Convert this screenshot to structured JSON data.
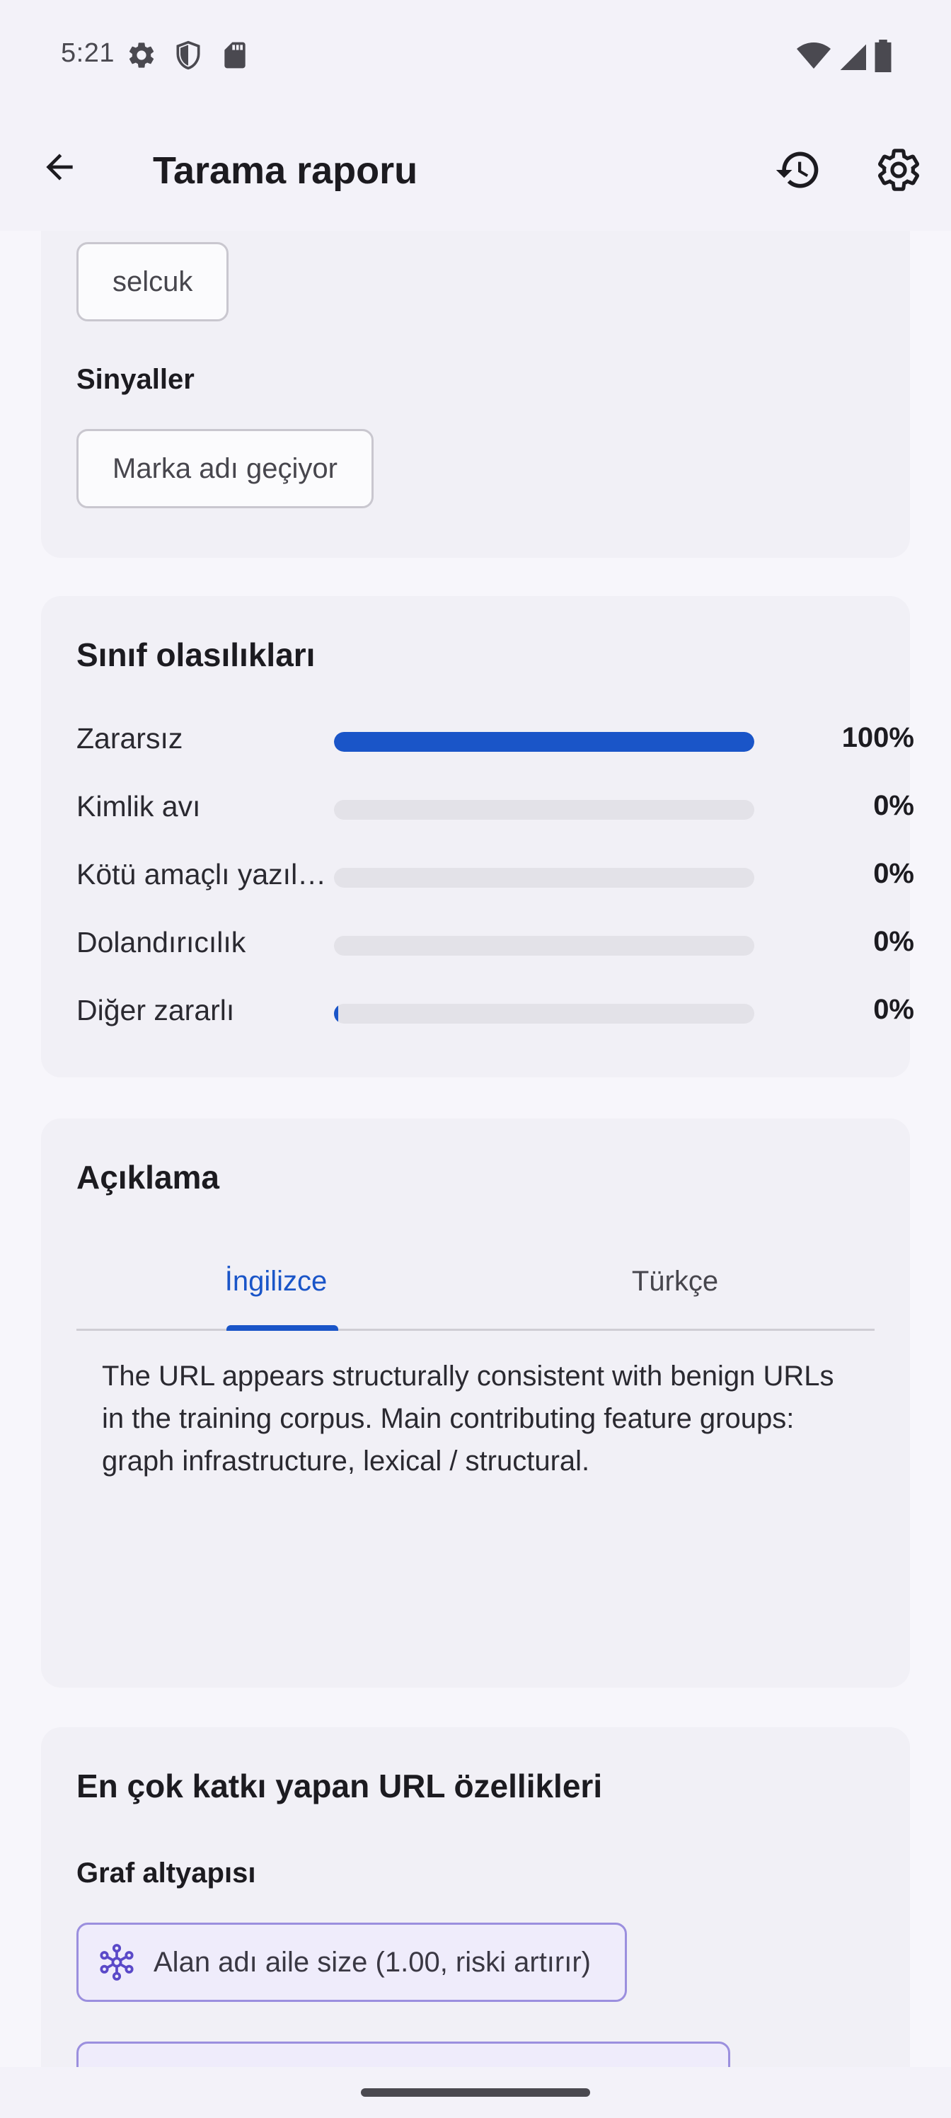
{
  "status_bar": {
    "time": "5:21",
    "left_icons": [
      "gear-icon",
      "shield-icon",
      "sd-card-icon"
    ],
    "right_icons": [
      "wifi-icon",
      "cell-signal-icon",
      "battery-icon"
    ]
  },
  "app_bar": {
    "title": "Tarama raporu",
    "back_icon": "arrow-back-icon",
    "history_icon": "history-icon",
    "settings_icon": "gear-icon"
  },
  "brand_card": {
    "brand_chip": "selcuk",
    "signals_label": "Sinyaller",
    "signal_chip": "Marka adı geçiyor"
  },
  "probabilities": {
    "title": "Sınıf olasılıkları",
    "rows": [
      {
        "label": "Zararsız",
        "value": "100%",
        "fraction": 1.0
      },
      {
        "label": "Kimlik avı",
        "value": "0%",
        "fraction": 0.0
      },
      {
        "label": "Kötü amaçlı yazıl…",
        "value": "0%",
        "fraction": 0.0
      },
      {
        "label": "Dolandırıcılık",
        "value": "0%",
        "fraction": 0.0
      },
      {
        "label": "Diğer zararlı",
        "value": "0%",
        "fraction": 0.004
      }
    ],
    "accent_color": "#1a55c8"
  },
  "explanation": {
    "title": "Açıklama",
    "tabs": [
      {
        "label": "İngilizce",
        "active": true
      },
      {
        "label": "Türkçe",
        "active": false
      }
    ],
    "text": "The URL appears structurally consistent with benign URLs in the training corpus. Main contributing feature groups: graph infrastructure, lexical / structural."
  },
  "features": {
    "title": "En çok katkı yapan URL özellikleri",
    "group_label": "Graf altyapısı",
    "items": [
      {
        "label": "Alan adı aile size (1.00, riski artırır)",
        "icon": "graph-network-icon"
      }
    ]
  }
}
